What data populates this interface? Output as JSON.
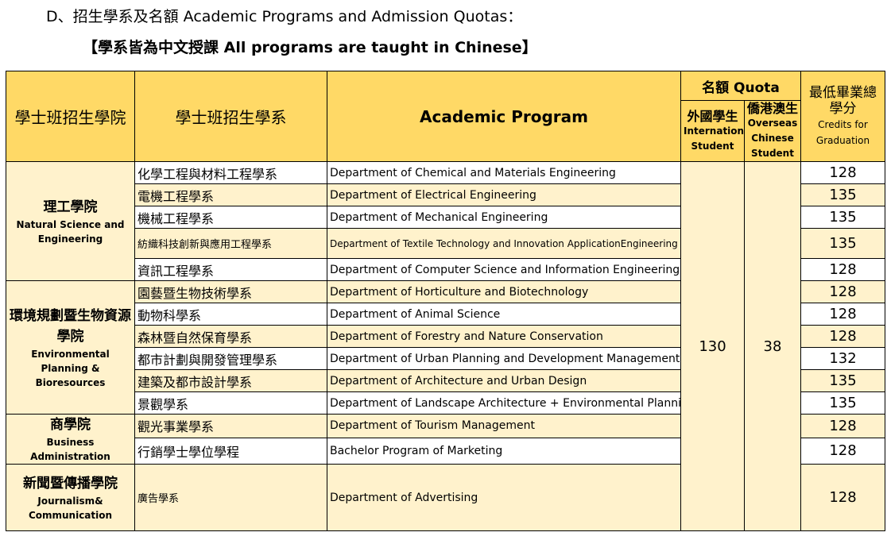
{
  "heading": {
    "line1": "D、招生學系及名額 Academic Programs and Admission Quotas：",
    "line2": "【學系皆為中文授課 All programs are taught in Chinese】"
  },
  "table": {
    "headers": {
      "college": "學士班招生學院",
      "department": "學士班招生學系",
      "program": "Academic  Program",
      "quota": "名額 Quota",
      "intl_zh": "外國學生",
      "intl_en": "International Student",
      "overseas_zh": "僑港澳生",
      "overseas_en": "Overseas Chinese Student",
      "credits_zh": "最低畢業總學分",
      "credits_en": "Credits for Graduation"
    },
    "quota_international": "130",
    "quota_overseas": "38",
    "colleges": [
      {
        "name_zh": "理工學院",
        "name_en": "Natural Science and Engineering",
        "programs": [
          {
            "dept_zh": "化學工程與材料工程學系",
            "dept_en": "Department of Chemical and Materials Engineering",
            "credits": "128"
          },
          {
            "dept_zh": "電機工程學系",
            "dept_en": "Department of Electrical Engineering",
            "credits": "135"
          },
          {
            "dept_zh": "機械工程學系",
            "dept_en": "Department of Mechanical Engineering",
            "credits": "135"
          },
          {
            "dept_zh": "紡織科技創新與應用工程學系",
            "dept_en": "Department of Textile Technology and Innovation ApplicationEngineering",
            "credits": "135"
          },
          {
            "dept_zh": "資訊工程學系",
            "dept_en": "Department of Computer Science and Information Engineering",
            "credits": "128"
          }
        ]
      },
      {
        "name_zh": "環境規劃暨生物資源學院",
        "name_en": "Environmental Planning & Bioresources",
        "programs": [
          {
            "dept_zh": "園藝暨生物技術學系",
            "dept_en": "Department of Horticulture and Biotechnology",
            "credits": "128"
          },
          {
            "dept_zh": "動物科學系",
            "dept_en": "Department of Animal Science",
            "credits": "128"
          },
          {
            "dept_zh": "森林暨自然保育學系",
            "dept_en": "Department of Forestry and Nature Conservation",
            "credits": "128"
          },
          {
            "dept_zh": "都市計劃與開發管理學系",
            "dept_en": "Department of Urban Planning and Development Management",
            "credits": "132"
          },
          {
            "dept_zh": "建築及都市設計學系",
            "dept_en": "Department of Architecture and Urban Design",
            "credits": "135"
          },
          {
            "dept_zh": "景觀學系",
            "dept_en": "Department of Landscape Architecture + Environmental Planning",
            "credits": "135"
          }
        ]
      },
      {
        "name_zh": "商學院",
        "name_en": "Business Administration",
        "programs": [
          {
            "dept_zh": "觀光事業學系",
            "dept_en": "Department of Tourism Management",
            "credits": "128"
          },
          {
            "dept_zh": "行銷學士學位學程",
            "dept_en": "Bachelor Program of Marketing",
            "credits": "128"
          }
        ]
      },
      {
        "name_zh": "新聞暨傳播學院",
        "name_en": "Journalism& Communication",
        "programs": [
          {
            "dept_zh": "廣告學系",
            "dept_en": "Department of Advertising",
            "credits": "128"
          }
        ]
      }
    ]
  }
}
